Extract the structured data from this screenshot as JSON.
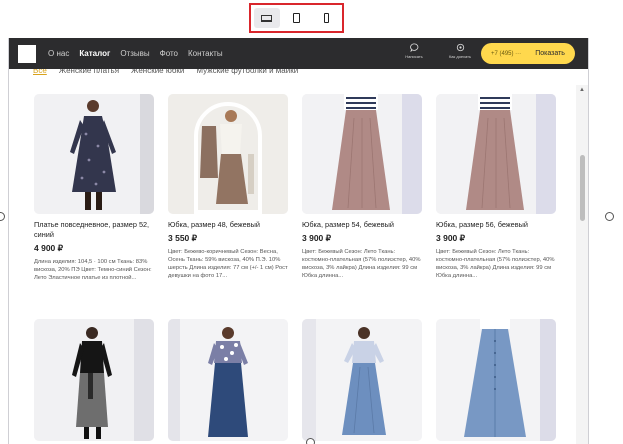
{
  "device_toolbar": {
    "modes": [
      "desktop",
      "tablet",
      "phone"
    ],
    "active": "desktop"
  },
  "header": {
    "nav": [
      "О нас",
      "Каталог",
      "Отзывы",
      "Фото",
      "Контакты"
    ],
    "active_nav": "Каталог",
    "actions": [
      {
        "icon": "chat-icon",
        "label": "Написать"
      },
      {
        "icon": "whatsapp-icon",
        "label": "Как доехать"
      }
    ],
    "phone": "+7 (495) ···",
    "show_label": "Показать"
  },
  "filters": [
    "Все",
    "Женские платья",
    "Женские юбки",
    "Мужские футболки и майки"
  ],
  "products": [
    {
      "name": "Платье повседневное, размер 52, синий",
      "price": "4 900 ₽",
      "description": "Длина изделия: 104,5 · 100 см Ткань: 83% вискоза, 20% ПЭ Цвет: Темно-синий Сезон: Лето Эластичное платье из плотной..."
    },
    {
      "name": "Юбка, размер 48, бежевый",
      "price": "3 550 ₽",
      "description": "Цвет: Бежево-коричневый Сезон: Весна, Осень Ткань: 59% вискоза, 40% П.Э. 10% шерсть Длина изделия: 77 см (+/- 1 см) Рост девушки на фото 17..."
    },
    {
      "name": "Юбка, размер 54, бежевый",
      "price": "3 900 ₽",
      "description": "Цвет: Бежевый Сезон: Лето Ткань: костюмно-плательная (57% полиэстер, 40% вискоза, 3% лайкра) Длина изделия: 99 см Юбка длинна..."
    },
    {
      "name": "Юбка, размер 56, бежевый",
      "price": "3 900 ₽",
      "description": "Цвет: Бежевый Сезон: Лето Ткань: костюмно-плательная (57% полиэстер, 40% вискоза, 3% лайкра) Длина изделия: 99 см Юбка длинна..."
    },
    {
      "name": "",
      "price": "",
      "description": ""
    },
    {
      "name": "",
      "price": "",
      "description": ""
    },
    {
      "name": "",
      "price": "",
      "description": ""
    },
    {
      "name": "",
      "price": "",
      "description": ""
    }
  ],
  "colors": {
    "accent_border": "#d9262c",
    "header_bg": "#2c2c2e",
    "phone_button": "#ffd84d"
  }
}
